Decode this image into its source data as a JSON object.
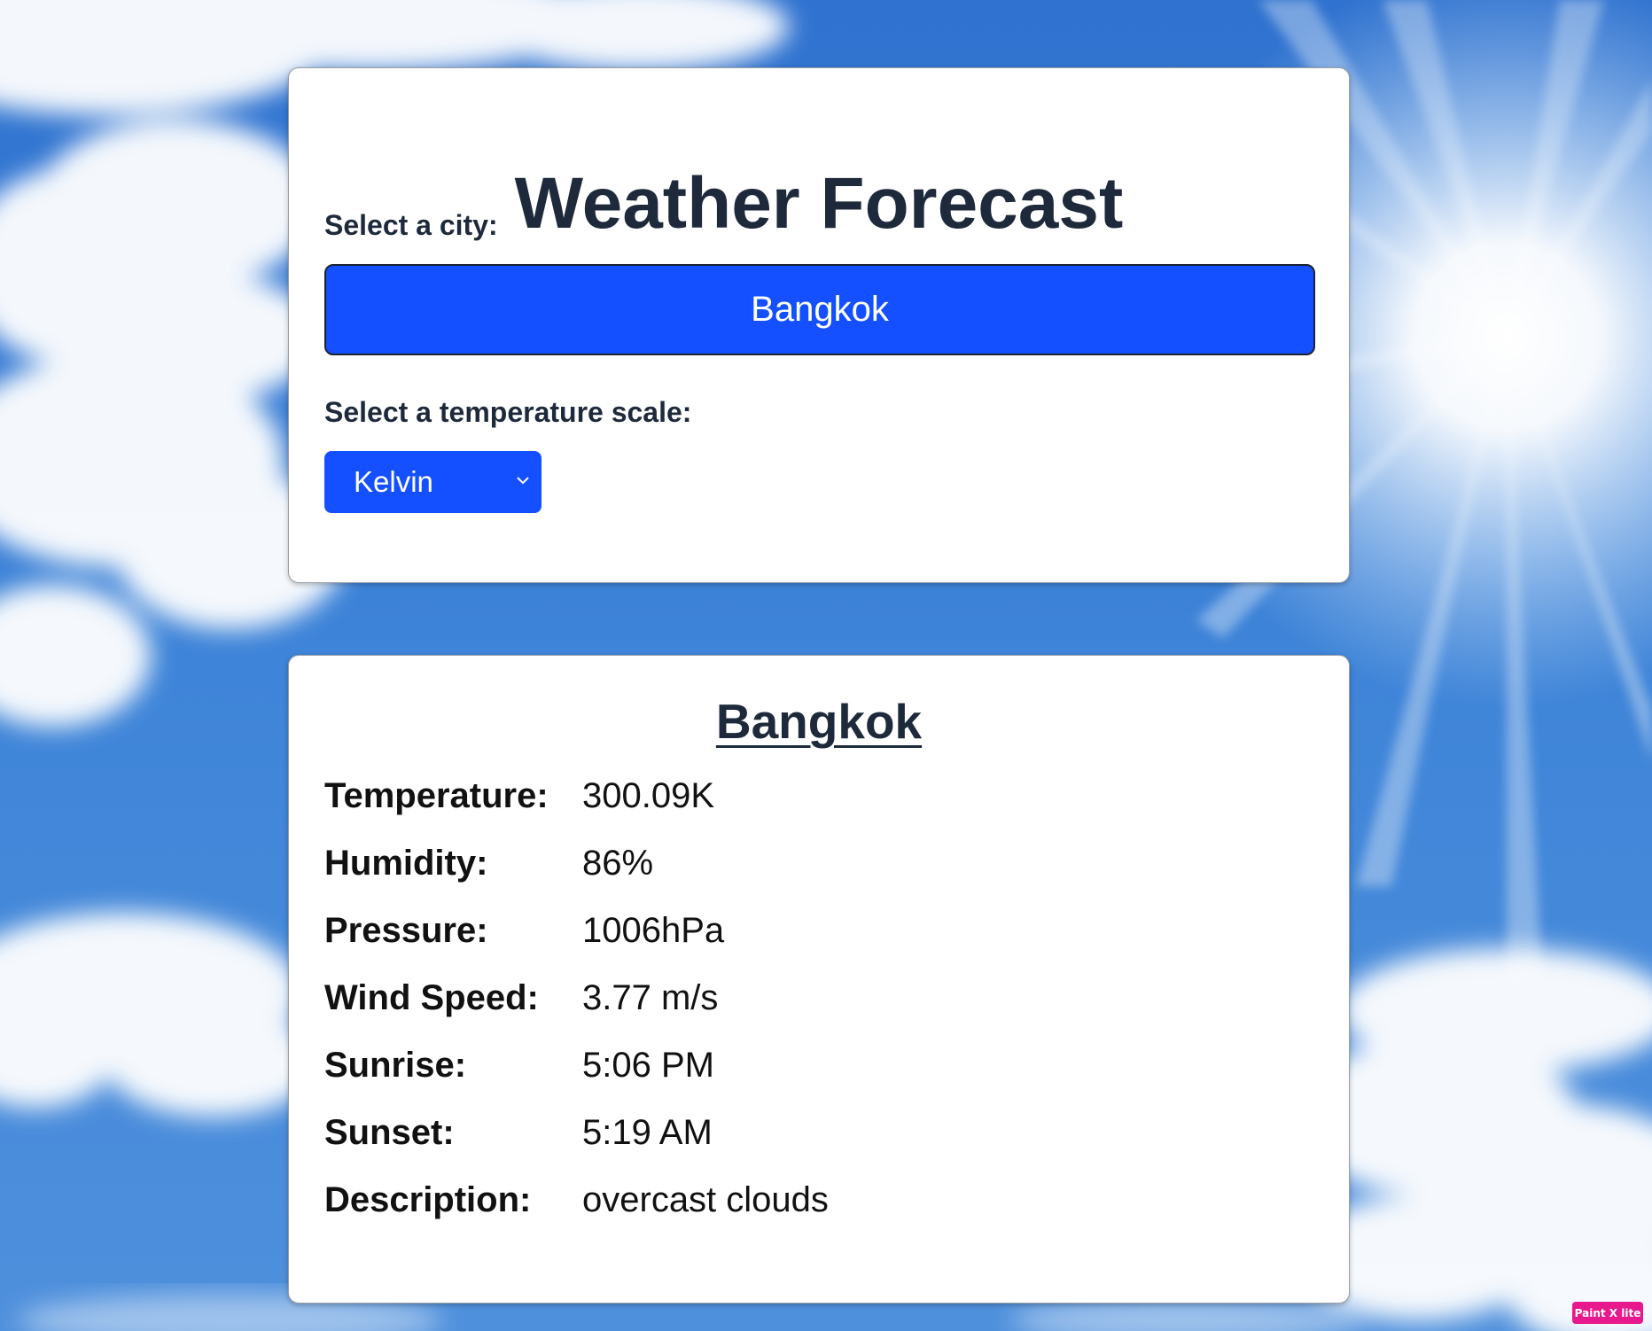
{
  "app": {
    "title": "Weather Forecast"
  },
  "controls": {
    "city_label": "Select a city:",
    "city_button": "Bangkok",
    "scale_label": "Select a temperature scale:",
    "scale_selected": "Kelvin"
  },
  "result": {
    "city": "Bangkok",
    "rows": [
      {
        "label": "Temperature:",
        "value": "300.09K"
      },
      {
        "label": "Humidity:",
        "value": "86%"
      },
      {
        "label": "Pressure:",
        "value": "1006hPa"
      },
      {
        "label": "Wind Speed:",
        "value": "3.77 m/s"
      },
      {
        "label": "Sunrise:",
        "value": "5:06 PM"
      },
      {
        "label": "Sunset:",
        "value": "5:19 AM"
      },
      {
        "label": "Description:",
        "value": "overcast clouds"
      }
    ]
  },
  "badge": "Paint X lite",
  "colors": {
    "accent_button": "#1450ff",
    "text_dark": "#1e2a3b",
    "card_bg": "#ffffff",
    "sky": "#3b7fd4"
  }
}
